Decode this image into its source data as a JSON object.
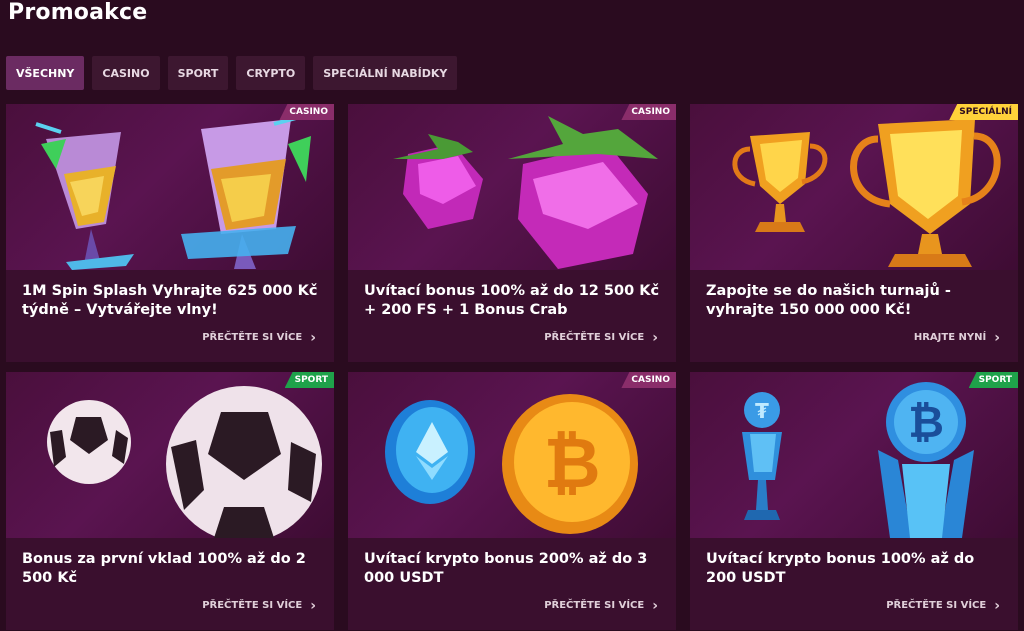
{
  "page": {
    "title": "Promoakce"
  },
  "tabs": [
    {
      "label": "VŠECHNY",
      "active": true
    },
    {
      "label": "CASINO",
      "active": false
    },
    {
      "label": "SPORT",
      "active": false
    },
    {
      "label": "CRYPTO",
      "active": false
    },
    {
      "label": "SPECIÁLNÍ NABÍDKY",
      "active": false
    }
  ],
  "colors": {
    "background": "#2a0b1f",
    "card": "#3a0f2e",
    "tab_active": "#6b2b62",
    "badge_casino": "#8a2d6a",
    "badge_special": "#ffd23a",
    "badge_sport": "#1fa24a"
  },
  "promos": [
    {
      "badge": "CASINO",
      "badge_type": "casino",
      "art": "cocktail-icon",
      "title": "1M Spin Splash Vyhrajte 625 000 Kč týdně – Vytvářejte vlny!",
      "cta": "PŘEČTĚTE SI VÍCE"
    },
    {
      "badge": "CASINO",
      "badge_type": "casino",
      "art": "raspberry-icon",
      "title": "Uvítací bonus 100% až do 12 500 Kč + 200 FS + 1 Bonus Crab",
      "cta": "PŘEČTĚTE SI VÍCE"
    },
    {
      "badge": "SPECIÁLNÍ",
      "badge_type": "special",
      "art": "trophy-icon",
      "title": "Zapojte se do našich turnajů - vyhrajte 150 000 000 Kč!",
      "cta": "HRAJTE NYNÍ"
    },
    {
      "badge": "SPORT",
      "badge_type": "sport",
      "art": "soccer-ball-icon",
      "title": "Bonus za první vklad 100% až do 2 500 Kč",
      "cta": "PŘEČTĚTE SI VÍCE"
    },
    {
      "badge": "CASINO",
      "badge_type": "casino",
      "art": "crypto-coin-icon",
      "title": "Uvítací krypto bonus 200% až do 3 000 USDT",
      "cta": "PŘEČTĚTE SI VÍCE"
    },
    {
      "badge": "SPORT",
      "badge_type": "sport",
      "art": "bitcoin-trophy-icon",
      "title": "Uvítací krypto bonus 100% až do 200 USDT",
      "cta": "PŘEČTĚTE SI VÍCE"
    }
  ]
}
